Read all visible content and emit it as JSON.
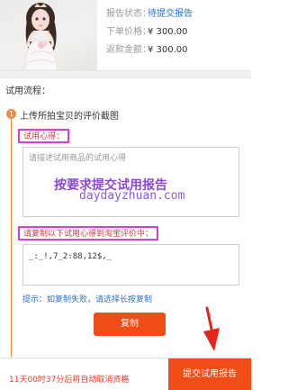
{
  "product": {
    "status_label": "报告状态：",
    "status_value": "待提交报告",
    "price_label": "下单价格：",
    "price_value": "¥ 300.00",
    "refund_label": "返款金额：",
    "refund_value": "¥ 300.00"
  },
  "process": {
    "title": "试用流程：",
    "step_number": "1",
    "step_text": "上传所拍宝贝的评价截图",
    "review_label": "试用心得：",
    "review_placeholder": "请描述试用商品的试用心得",
    "overlay_text": "按要求提交试用报告",
    "watermark": "daydayzhuan.com",
    "copy_label": "请复制以下试用心得到淘宝评价中：",
    "copy_content": "_:_!,7_2:88,12$,_",
    "tip": "提示：如复制失败，请选择长按复制",
    "copy_button": "复制"
  },
  "bottom": {
    "countdown": "11天00时37分后将自动取消资格",
    "submit_button": "提交试用报告"
  },
  "colors": {
    "accent": "#f04d16",
    "link": "#2e72c4",
    "highlight_border": "#d63fd6",
    "arrow": "#e8231a"
  }
}
